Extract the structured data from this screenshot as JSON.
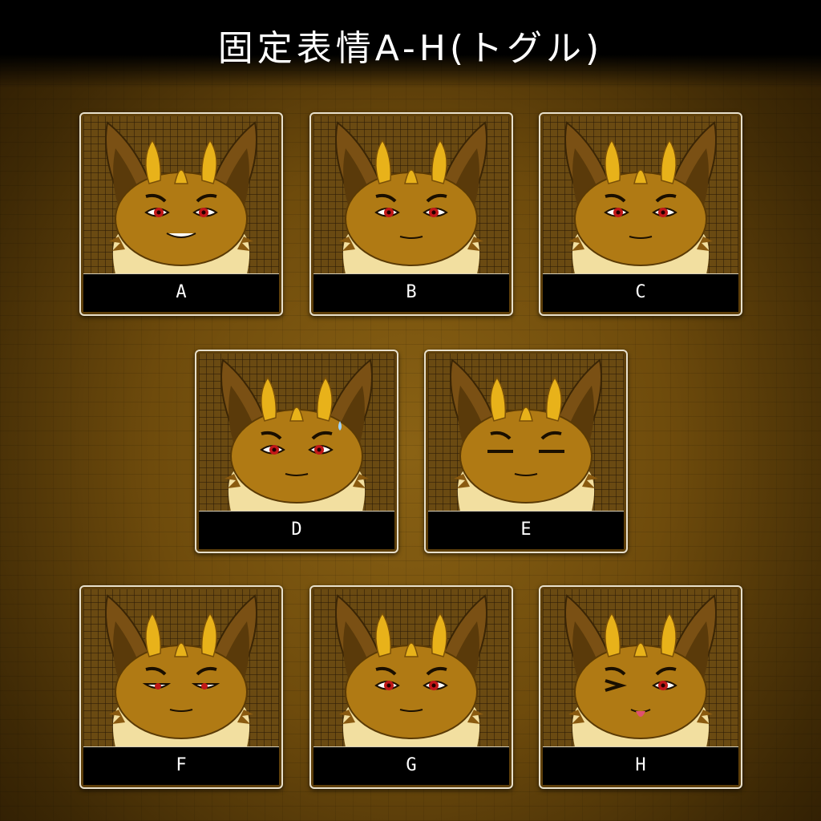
{
  "title": "固定表情A-H(トグル)",
  "colors": {
    "fur": "#b07a14",
    "ear": "#7a5014",
    "horn": "#e8b21a",
    "cream": "#f2dfa0",
    "eye": "#c21818"
  },
  "expressions": [
    {
      "label": "A",
      "eyes": "smirk"
    },
    {
      "label": "B",
      "eyes": "open"
    },
    {
      "label": "C",
      "eyes": "open"
    },
    {
      "label": "D",
      "eyes": "sweat"
    },
    {
      "label": "E",
      "eyes": "closed"
    },
    {
      "label": "F",
      "eyes": "half"
    },
    {
      "label": "G",
      "eyes": "open"
    },
    {
      "label": "H",
      "eyes": "wink"
    }
  ]
}
